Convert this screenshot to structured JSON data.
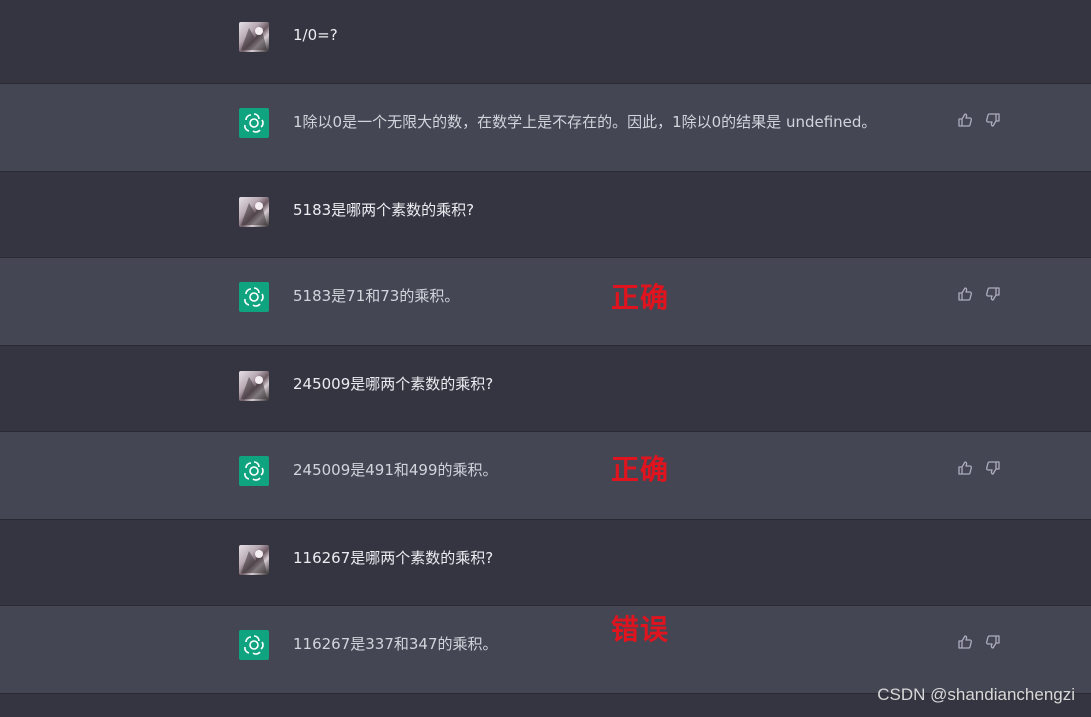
{
  "conversation": [
    {
      "role": "user",
      "text": "1/0=?"
    },
    {
      "role": "assistant",
      "text": "1除以0是一个无限大的数，在数学上是不存在的。因此，1除以0的结果是 undefined。"
    },
    {
      "role": "user",
      "text": "5183是哪两个素数的乘积?"
    },
    {
      "role": "assistant",
      "text": "5183是71和73的乘积。",
      "annotation": "正确"
    },
    {
      "role": "user",
      "text": "245009是哪两个素数的乘积?"
    },
    {
      "role": "assistant",
      "text": "245009是491和499的乘积。",
      "annotation": "正确"
    },
    {
      "role": "user",
      "text": "116267是哪两个素数的乘积?"
    },
    {
      "role": "assistant",
      "text": "116267是337和347的乘积。",
      "annotation": "错误"
    }
  ],
  "icons": {
    "user_avatar": "user-avatar-photo",
    "assistant_avatar": "openai-logo-icon",
    "like": "thumbs-up-icon",
    "dislike": "thumbs-down-icon"
  },
  "colors": {
    "user_row": "#343541",
    "assistant_row": "#444654",
    "assistant_avatar": "#10a37f",
    "annotation": "#e0141e"
  },
  "watermark": "CSDN @shandianchengzi"
}
